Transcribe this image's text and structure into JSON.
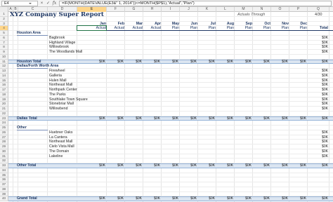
{
  "formula_bar": {
    "cell_ref": "E4",
    "cancel_icon": "×",
    "enter_icon": "✓",
    "fx_label": "fx",
    "formula": "=IF(MONTH(DATEVALUE(E3&\" 1, 2014\"))<=MONTH($P$1),\"Actual\",\"Plan\")"
  },
  "columns": [
    "A",
    "B",
    "C",
    "D",
    "E",
    "F",
    "G",
    "H",
    "I",
    "J",
    "K",
    "L",
    "M",
    "N",
    "O",
    "P",
    "Q"
  ],
  "selected_column": "E",
  "rows": [
    "1",
    "2",
    "3",
    "4",
    "5",
    "6",
    "7",
    "8",
    "9",
    "10",
    "11",
    "12",
    "13",
    "14",
    "15",
    "16",
    "17",
    "18",
    "19",
    "20",
    "21",
    "22",
    "23",
    "24",
    "25",
    "26",
    "27",
    "28",
    "29",
    "30",
    "31",
    "32",
    "33",
    "34",
    "35",
    "36",
    "37",
    "38",
    "39",
    "40"
  ],
  "selected_row": "4",
  "sheet": {
    "title": "XYZ Company Super Report",
    "actuals_through_label": "Actuals Through",
    "actuals_through_value": "4/30",
    "months": [
      "Jan",
      "Feb",
      "Mar",
      "Apr",
      "May",
      "Jun",
      "Jul",
      "Aug",
      "Sep",
      "Oct",
      "Nov",
      "Dec"
    ],
    "types": [
      "Actual",
      "Actual",
      "Actual",
      "Actual",
      "Plan",
      "Plan",
      "Plan",
      "Plan",
      "Plan",
      "Plan",
      "Plan",
      "Plan"
    ],
    "total_header": "Total",
    "sections": [
      {
        "name": "Houston Area",
        "locations": [
          "Bagbrook",
          "Highland Village",
          "Willowbrook",
          "The Woodlands Mall"
        ],
        "location_values": [
          "$0K",
          "$0K",
          "$0K",
          "$0K"
        ],
        "total_label": "Houston Total",
        "total_values": [
          "$0K",
          "$0K",
          "$0K",
          "$0K",
          "$0K",
          "$0K",
          "$0K",
          "$0K",
          "$0K",
          "$0K",
          "$0K",
          "$0K",
          "$0K"
        ]
      },
      {
        "name": "Dallas/Forth Worth Area",
        "locations": [
          "Firewheel",
          "Galleria",
          "Hulen Mall",
          "Northeast Mall",
          "Northpark Center",
          "The Parks",
          "Southlake Town Square",
          "Stonebriar Mall",
          "Willowbend"
        ],
        "location_values": [
          "$0K",
          "$0K",
          "$0K",
          "$0K",
          "$0K",
          "$0K",
          "$0K",
          "$0K",
          "$0K"
        ],
        "total_label": "Dallas Total",
        "total_values": [
          "$0K",
          "$0K",
          "$0K",
          "$0K",
          "$0K",
          "$0K",
          "$0K",
          "$0K",
          "$0K",
          "$0K",
          "$0K",
          "$0K",
          "$0K"
        ]
      },
      {
        "name": "Other",
        "locations": [
          "Huebner Oaks",
          "La Cantera",
          "Northeast Mall",
          "Cielo Vista Mall",
          "The Domain",
          "Lakeline"
        ],
        "location_values": [
          "$0K",
          "$0K",
          "$0K",
          "$0K",
          "$0K",
          "$0K"
        ],
        "total_label": "Other Total",
        "total_values": [
          "$0K",
          "$0K",
          "$0K",
          "$0K",
          "$0K",
          "$0K",
          "$0K",
          "$0K",
          "$0K",
          "$0K",
          "$0K",
          "$0K",
          "$0K"
        ]
      }
    ],
    "grand_total_label": "Grand Total",
    "grand_total_values": [
      "$0K",
      "$0K",
      "$0K",
      "$0K",
      "$0K",
      "$0K",
      "$0K",
      "$0K",
      "$0K",
      "$0K",
      "$0K",
      "$0K",
      "$0K"
    ]
  },
  "colors": {
    "selection": "#217346",
    "header_highlight": "#ffd68a",
    "title": "#1f3864",
    "total_band": "#dbe5f1"
  }
}
